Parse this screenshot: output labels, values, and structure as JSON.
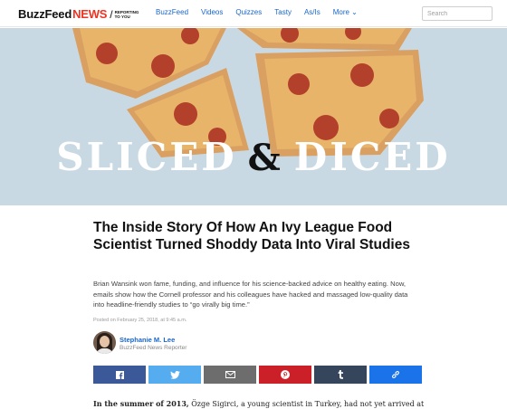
{
  "header": {
    "logo_main": "BuzzFeed",
    "logo_accent": "NEWS",
    "logo_tagline": "REPORTING TO YOU",
    "nav": [
      {
        "label": "BuzzFeed"
      },
      {
        "label": "Videos"
      },
      {
        "label": "Quizzes"
      },
      {
        "label": "Tasty"
      },
      {
        "label": "As/Is"
      },
      {
        "label": "More ⌄"
      }
    ],
    "search_placeholder": "Search"
  },
  "hero": {
    "word1": "SLICED",
    "amp": "&",
    "word2": "DICED",
    "colors": {
      "background": "#c9d9e3",
      "crust": "#d9a062",
      "cheese": "#e8b46a",
      "pepperoni": "#b3402a"
    }
  },
  "article": {
    "headline": "The Inside Story Of How An Ivy League Food Scientist Turned Shoddy Data Into Viral Studies",
    "dek": "Brian Wansink won fame, funding, and influence for his science-backed advice on healthy eating. Now, emails show how the Cornell professor and his colleagues have hacked and massaged low-quality data into headline-friendly studies to “go virally big time.”",
    "posted": "Posted on February 25, 2018, at 9:45 a.m.",
    "author_name": "Stephanie M. Lee",
    "author_role": "BuzzFeed News Reporter",
    "share": [
      {
        "icon": "facebook-icon",
        "color": "#3b5998"
      },
      {
        "icon": "twitter-icon",
        "color": "#55acee"
      },
      {
        "icon": "email-icon",
        "color": "#6d6d6d"
      },
      {
        "icon": "pinterest-icon",
        "color": "#cb2027"
      },
      {
        "icon": "tumblr-icon",
        "color": "#35465c"
      },
      {
        "icon": "link-icon",
        "color": "#1a73e8"
      }
    ],
    "body_start": "In the summer of 2013,",
    "body_rest": " Özge Sigirci, a young scientist in Turkey, had not yet arrived at"
  }
}
